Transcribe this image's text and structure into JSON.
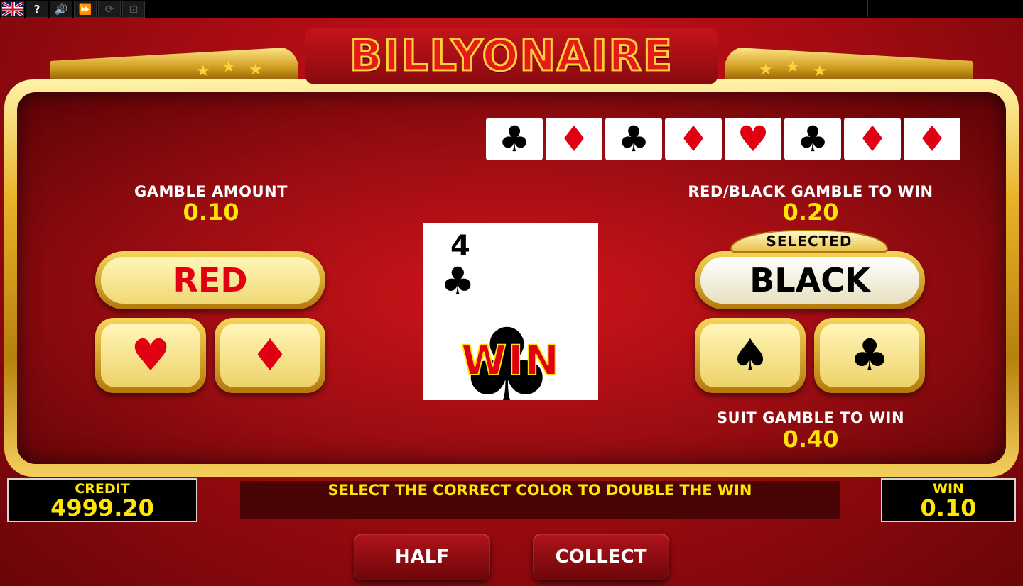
{
  "game_title": "BILLYONAIRE",
  "toolbar": {
    "help": "?",
    "sound": "🔊",
    "fast": "⏩",
    "autoplay": "⟳",
    "fullscreen": "⊡"
  },
  "history": [
    {
      "suit": "♣",
      "color": "black"
    },
    {
      "suit": "♦",
      "color": "red"
    },
    {
      "suit": "♣",
      "color": "black"
    },
    {
      "suit": "♦",
      "color": "red"
    },
    {
      "suit": "♥",
      "color": "red"
    },
    {
      "suit": "♣",
      "color": "black"
    },
    {
      "suit": "♦",
      "color": "red"
    },
    {
      "suit": "♦",
      "color": "red"
    }
  ],
  "gamble_amount": {
    "label": "GAMBLE AMOUNT",
    "value": "0.10"
  },
  "red_black": {
    "label": "RED/BLACK GAMBLE TO WIN",
    "value": "0.20"
  },
  "suit_gamble": {
    "label": "SUIT GAMBLE TO WIN",
    "value": "0.40"
  },
  "buttons": {
    "red": "RED",
    "black": "BLACK",
    "selected": "SELECTED",
    "half": "HALF",
    "collect": "COLLECT"
  },
  "suits": {
    "heart": "♥",
    "diamond": "♦",
    "spade": "♠",
    "club": "♣"
  },
  "card": {
    "rank": "4",
    "suit": "♣",
    "result": "WIN"
  },
  "credit": {
    "label": "CREDIT",
    "value": "4999.20"
  },
  "win": {
    "label": "WIN",
    "value": "0.10"
  },
  "message": "SELECT THE CORRECT COLOR TO DOUBLE THE WIN",
  "colors": {
    "red": "#e00012",
    "yellow": "#ffe600",
    "gold": "#e7b328"
  }
}
